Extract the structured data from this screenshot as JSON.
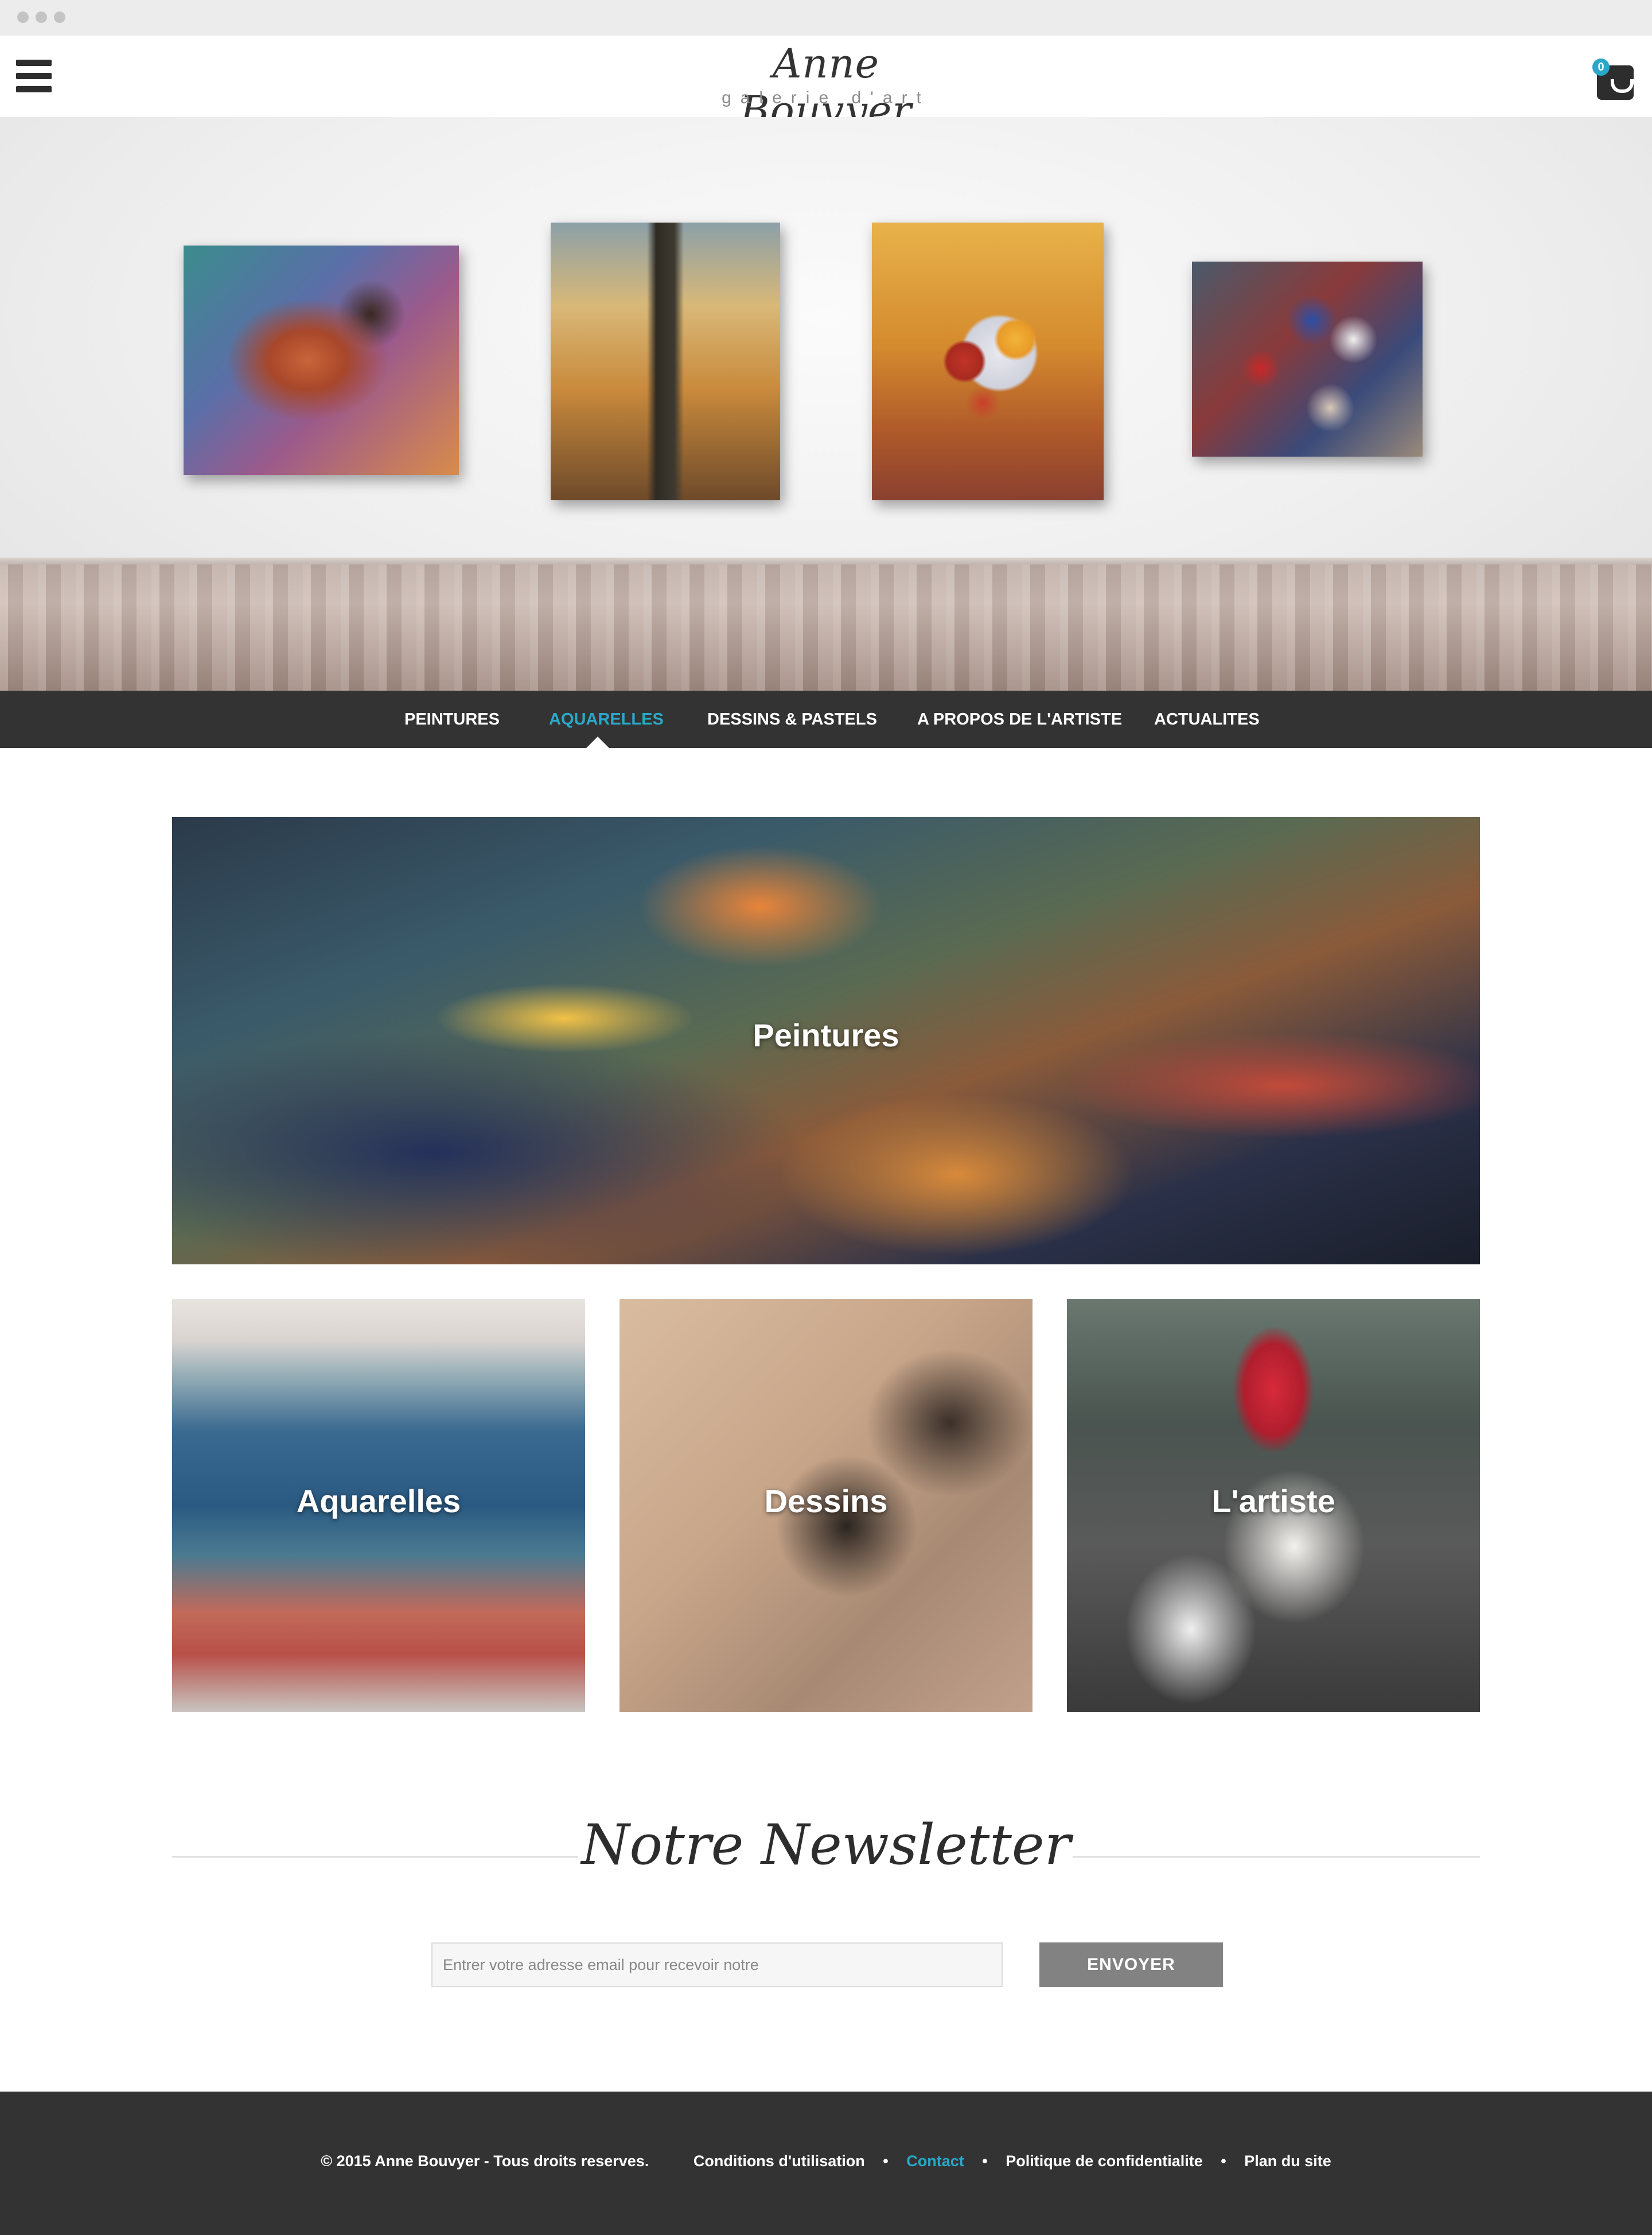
{
  "header": {
    "logo_name": "Anne Bouvyer",
    "logo_sub": "galerie d'art",
    "cart_count": "0"
  },
  "nav": {
    "items": [
      {
        "label": "PEINTURES",
        "active": false
      },
      {
        "label": "AQUARELLES",
        "active": true
      },
      {
        "label": "DESSINS & PASTELS",
        "active": false
      },
      {
        "label": "A PROPOS DE L'ARTISTE",
        "active": false
      },
      {
        "label": "ACTUALITES",
        "active": false
      }
    ]
  },
  "tiles": {
    "main": "Peintures",
    "aquarelles": "Aquarelles",
    "dessins": "Dessins",
    "artiste": "L'artiste"
  },
  "newsletter": {
    "title": "Notre Newsletter",
    "placeholder": "Entrer votre adresse email pour recevoir notre",
    "button": "ENVOYER"
  },
  "footer": {
    "copyright": "© 2015 Anne Bouvyer - Tous droits reserves.",
    "links": [
      "Conditions d'utilisation",
      "Contact",
      "Politique de confidentialite",
      "Plan du site"
    ],
    "separator": "•"
  },
  "colors": {
    "accent": "#2aa8c9",
    "dark_bar": "#333333",
    "button_gray": "#828282"
  },
  "icons": {
    "menu": "hamburger-icon",
    "cart": "shopping-bag-icon"
  }
}
